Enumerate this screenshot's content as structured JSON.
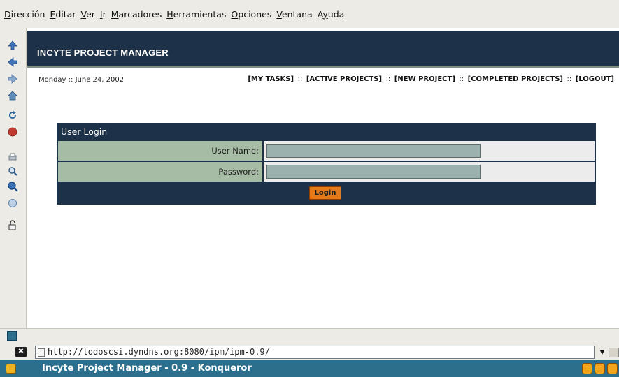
{
  "menu": [
    {
      "pre": "",
      "u": "D",
      "post": "irección"
    },
    {
      "pre": "",
      "u": "E",
      "post": "ditar"
    },
    {
      "pre": "",
      "u": "V",
      "post": "er"
    },
    {
      "pre": "",
      "u": "I",
      "post": "r"
    },
    {
      "pre": "",
      "u": "M",
      "post": "arcadores"
    },
    {
      "pre": "",
      "u": "H",
      "post": "erramientas"
    },
    {
      "pre": "",
      "u": "O",
      "post": "pciones"
    },
    {
      "pre": "",
      "u": "V",
      "post": "entana"
    },
    {
      "pre": "A",
      "u": "y",
      "post": "uda"
    }
  ],
  "toolbar_icons": [
    "up-arrow-icon",
    "back-arrow-icon",
    "forward-arrow-icon",
    "home-icon",
    "reload-icon",
    "stop-icon",
    "print-icon",
    "zoom-out-icon",
    "zoom-in-icon",
    "search-icon",
    "security-lock-icon"
  ],
  "app": {
    "title": "INCYTE PROJECT MANAGER",
    "date": "Monday :: June 24, 2002",
    "nav": {
      "my_tasks": "[MY TASKS]",
      "active_projects": "[ACTIVE PROJECTS]",
      "new_project": "[NEW PROJECT]",
      "completed_projects": "[COMPLETED PROJECTS]",
      "logout": "[LOGOUT]",
      "separator": "::"
    }
  },
  "login": {
    "title": "User Login",
    "username_label": "User Name:",
    "username_value": "",
    "password_label": "Password:",
    "password_value": "",
    "button": "Login"
  },
  "location": {
    "url": "http://todoscsi.dyndns.org:8080/ipm/ipm-0.9/"
  },
  "taskbar": {
    "title": "Incyte Project Manager - 0.9 - Konqueror"
  },
  "colors": {
    "header": "#1d3248",
    "label_cell": "#a6bca4",
    "input_bg": "#9ab1ad",
    "login_button": "#e27a1b",
    "taskbar": "#2c6f8c"
  }
}
